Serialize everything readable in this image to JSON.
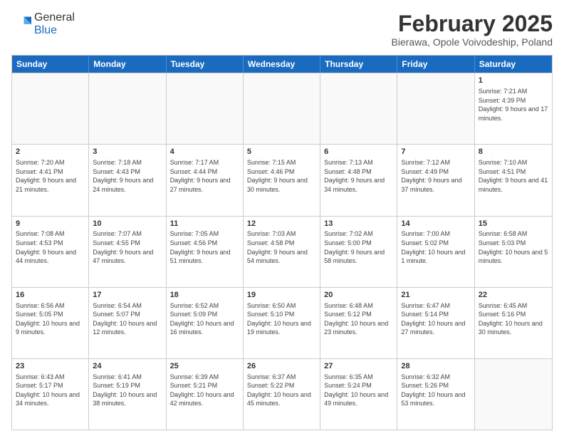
{
  "logo": {
    "general": "General",
    "blue": "Blue"
  },
  "header": {
    "month": "February 2025",
    "location": "Bierawa, Opole Voivodeship, Poland"
  },
  "weekdays": [
    "Sunday",
    "Monday",
    "Tuesday",
    "Wednesday",
    "Thursday",
    "Friday",
    "Saturday"
  ],
  "weeks": [
    [
      {
        "day": "",
        "info": "",
        "empty": true
      },
      {
        "day": "",
        "info": "",
        "empty": true
      },
      {
        "day": "",
        "info": "",
        "empty": true
      },
      {
        "day": "",
        "info": "",
        "empty": true
      },
      {
        "day": "",
        "info": "",
        "empty": true
      },
      {
        "day": "",
        "info": "",
        "empty": true
      },
      {
        "day": "1",
        "info": "Sunrise: 7:21 AM\nSunset: 4:39 PM\nDaylight: 9 hours and 17 minutes.",
        "empty": false
      }
    ],
    [
      {
        "day": "2",
        "info": "Sunrise: 7:20 AM\nSunset: 4:41 PM\nDaylight: 9 hours and 21 minutes.",
        "empty": false
      },
      {
        "day": "3",
        "info": "Sunrise: 7:18 AM\nSunset: 4:43 PM\nDaylight: 9 hours and 24 minutes.",
        "empty": false
      },
      {
        "day": "4",
        "info": "Sunrise: 7:17 AM\nSunset: 4:44 PM\nDaylight: 9 hours and 27 minutes.",
        "empty": false
      },
      {
        "day": "5",
        "info": "Sunrise: 7:15 AM\nSunset: 4:46 PM\nDaylight: 9 hours and 30 minutes.",
        "empty": false
      },
      {
        "day": "6",
        "info": "Sunrise: 7:13 AM\nSunset: 4:48 PM\nDaylight: 9 hours and 34 minutes.",
        "empty": false
      },
      {
        "day": "7",
        "info": "Sunrise: 7:12 AM\nSunset: 4:49 PM\nDaylight: 9 hours and 37 minutes.",
        "empty": false
      },
      {
        "day": "8",
        "info": "Sunrise: 7:10 AM\nSunset: 4:51 PM\nDaylight: 9 hours and 41 minutes.",
        "empty": false
      }
    ],
    [
      {
        "day": "9",
        "info": "Sunrise: 7:08 AM\nSunset: 4:53 PM\nDaylight: 9 hours and 44 minutes.",
        "empty": false
      },
      {
        "day": "10",
        "info": "Sunrise: 7:07 AM\nSunset: 4:55 PM\nDaylight: 9 hours and 47 minutes.",
        "empty": false
      },
      {
        "day": "11",
        "info": "Sunrise: 7:05 AM\nSunset: 4:56 PM\nDaylight: 9 hours and 51 minutes.",
        "empty": false
      },
      {
        "day": "12",
        "info": "Sunrise: 7:03 AM\nSunset: 4:58 PM\nDaylight: 9 hours and 54 minutes.",
        "empty": false
      },
      {
        "day": "13",
        "info": "Sunrise: 7:02 AM\nSunset: 5:00 PM\nDaylight: 9 hours and 58 minutes.",
        "empty": false
      },
      {
        "day": "14",
        "info": "Sunrise: 7:00 AM\nSunset: 5:02 PM\nDaylight: 10 hours and 1 minute.",
        "empty": false
      },
      {
        "day": "15",
        "info": "Sunrise: 6:58 AM\nSunset: 5:03 PM\nDaylight: 10 hours and 5 minutes.",
        "empty": false
      }
    ],
    [
      {
        "day": "16",
        "info": "Sunrise: 6:56 AM\nSunset: 5:05 PM\nDaylight: 10 hours and 9 minutes.",
        "empty": false
      },
      {
        "day": "17",
        "info": "Sunrise: 6:54 AM\nSunset: 5:07 PM\nDaylight: 10 hours and 12 minutes.",
        "empty": false
      },
      {
        "day": "18",
        "info": "Sunrise: 6:52 AM\nSunset: 5:09 PM\nDaylight: 10 hours and 16 minutes.",
        "empty": false
      },
      {
        "day": "19",
        "info": "Sunrise: 6:50 AM\nSunset: 5:10 PM\nDaylight: 10 hours and 19 minutes.",
        "empty": false
      },
      {
        "day": "20",
        "info": "Sunrise: 6:48 AM\nSunset: 5:12 PM\nDaylight: 10 hours and 23 minutes.",
        "empty": false
      },
      {
        "day": "21",
        "info": "Sunrise: 6:47 AM\nSunset: 5:14 PM\nDaylight: 10 hours and 27 minutes.",
        "empty": false
      },
      {
        "day": "22",
        "info": "Sunrise: 6:45 AM\nSunset: 5:16 PM\nDaylight: 10 hours and 30 minutes.",
        "empty": false
      }
    ],
    [
      {
        "day": "23",
        "info": "Sunrise: 6:43 AM\nSunset: 5:17 PM\nDaylight: 10 hours and 34 minutes.",
        "empty": false
      },
      {
        "day": "24",
        "info": "Sunrise: 6:41 AM\nSunset: 5:19 PM\nDaylight: 10 hours and 38 minutes.",
        "empty": false
      },
      {
        "day": "25",
        "info": "Sunrise: 6:39 AM\nSunset: 5:21 PM\nDaylight: 10 hours and 42 minutes.",
        "empty": false
      },
      {
        "day": "26",
        "info": "Sunrise: 6:37 AM\nSunset: 5:22 PM\nDaylight: 10 hours and 45 minutes.",
        "empty": false
      },
      {
        "day": "27",
        "info": "Sunrise: 6:35 AM\nSunset: 5:24 PM\nDaylight: 10 hours and 49 minutes.",
        "empty": false
      },
      {
        "day": "28",
        "info": "Sunrise: 6:32 AM\nSunset: 5:26 PM\nDaylight: 10 hours and 53 minutes.",
        "empty": false
      },
      {
        "day": "",
        "info": "",
        "empty": true
      }
    ]
  ]
}
